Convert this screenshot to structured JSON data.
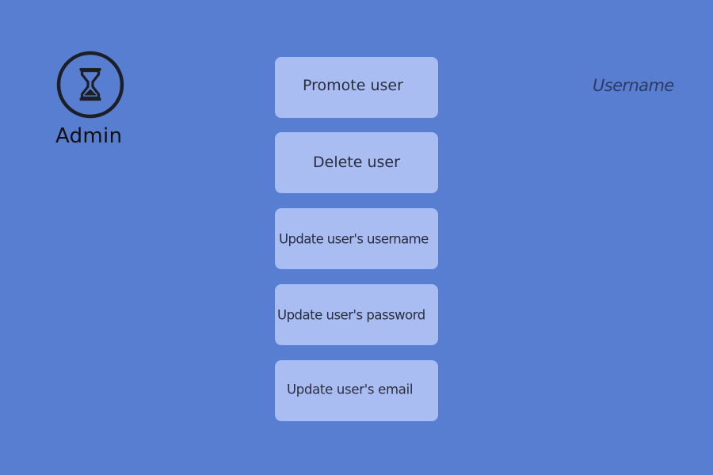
{
  "header": {
    "role_label": "Admin",
    "logo_icon": "hourglass-icon"
  },
  "actions": {
    "promote_label": "Promote user",
    "delete_label": "Delete user",
    "update_username_label": "Update user's username",
    "update_password_label": "Update user's password",
    "update_email_label": "Update user's email"
  },
  "user": {
    "username_label": "Username"
  },
  "colors": {
    "background": "#587ed1",
    "button_fill": "#a9bdf3",
    "button_text": "#2a2d3c",
    "icon_stroke": "#1d1f26"
  }
}
